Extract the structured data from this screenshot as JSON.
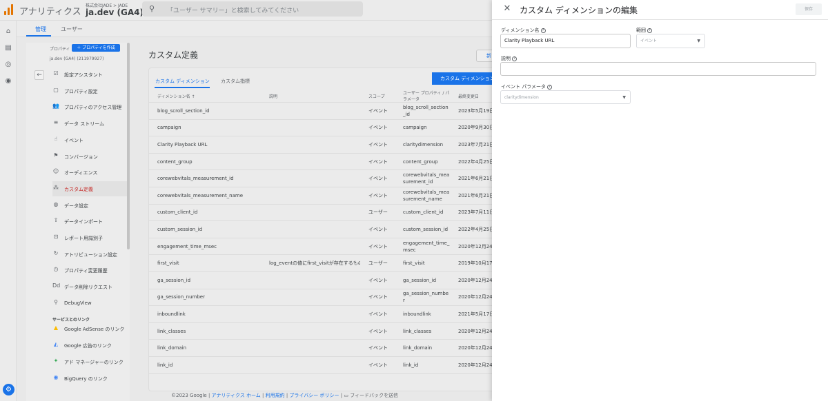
{
  "header": {
    "app_title": "アナリティクス",
    "account_breadcrumb": "株式会社JADE > JADE",
    "property": "ja.dev (GA4)",
    "search_placeholder": "「ユーザー サマリー」と検索してみてください"
  },
  "top_tabs": [
    "管理",
    "ユーザー"
  ],
  "nav": {
    "property_label": "プロパティ",
    "create_property": "プロパティを作成",
    "property_id": "ja.dev (GA4) (211979927)",
    "items": [
      {
        "icon": "checklist-icon",
        "label": "設定アシスタント"
      },
      {
        "icon": "property-icon",
        "label": "プロパティ設定"
      },
      {
        "icon": "people-icon",
        "label": "プロパティのアクセス管理"
      },
      {
        "icon": "stream-icon",
        "label": "データ ストリーム"
      },
      {
        "icon": "event-icon",
        "label": "イベント"
      },
      {
        "icon": "flag-icon",
        "label": "コンバージョン"
      },
      {
        "icon": "audience-icon",
        "label": "オーディエンス"
      },
      {
        "icon": "custom-icon",
        "label": "カスタム定義"
      },
      {
        "icon": "database-icon",
        "label": "データ設定"
      },
      {
        "icon": "upload-icon",
        "label": "データインポート"
      },
      {
        "icon": "id-icon",
        "label": "レポート用識別子"
      },
      {
        "icon": "attribution-icon",
        "label": "アトリビューション設定"
      },
      {
        "icon": "history-icon",
        "label": "プロパティ変更履歴"
      },
      {
        "icon": "delete-request-icon",
        "label": "データ削除リクエスト"
      },
      {
        "icon": "debug-icon",
        "label": "DebugView"
      }
    ],
    "links_section": "サービスとのリンク",
    "links": [
      {
        "icon": "adsense-icon",
        "label": "Google AdSense のリンク"
      },
      {
        "icon": "google-ads-icon",
        "label": "Google 広告のリンク"
      },
      {
        "icon": "ad-manager-icon",
        "label": "アド マネージャーのリンク"
      },
      {
        "icon": "bigquery-icon",
        "label": "BigQuery のリンク"
      }
    ],
    "active_index": 7
  },
  "main": {
    "title": "カスタム定義",
    "new_button": "新",
    "tabs": [
      "カスタム ディメンション",
      "カスタム指標"
    ],
    "create_button": "カスタム ディメンション",
    "columns": [
      "ディメンション名 ↑",
      "説明",
      "スコープ",
      "ユーザー プロパティ / パラメータ",
      "最終変更日"
    ],
    "rows": [
      [
        "blog_scroll_section_id",
        "",
        "イベント",
        "blog_scroll_section_id",
        "2023年5月19日"
      ],
      [
        "campaign",
        "",
        "イベント",
        "campaign",
        "2020年9月30日"
      ],
      [
        "Clarity Playback URL",
        "",
        "イベント",
        "claritydimension",
        "2023年7月21日"
      ],
      [
        "content_group",
        "",
        "イベント",
        "content_group",
        "2022年4月25日"
      ],
      [
        "corewebvitals_measurement_id",
        "",
        "イベント",
        "corewebvitals_measurement_id",
        "2021年6月21日"
      ],
      [
        "corewebvitals_measurement_name",
        "",
        "イベント",
        "corewebvitals_measurement_name",
        "2021年6月21日"
      ],
      [
        "custom_client_id",
        "",
        "ユーザー",
        "custom_client_id",
        "2023年7月11日"
      ],
      [
        "custom_session_id",
        "",
        "イベント",
        "custom_session_id",
        "2022年4月25日"
      ],
      [
        "engagement_time_msec",
        "",
        "イベント",
        "engagement_time_msec",
        "2020年12月24日"
      ],
      [
        "first_visit",
        "log_eventの値にfirst_visitが存在するもの",
        "ユーザー",
        "first_visit",
        "2019年10月17日"
      ],
      [
        "ga_session_id",
        "",
        "イベント",
        "ga_session_id",
        "2020年12月24日"
      ],
      [
        "ga_session_number",
        "",
        "イベント",
        "ga_session_number",
        "2020年12月24日"
      ],
      [
        "inboundlink",
        "",
        "イベント",
        "inboundlink",
        "2021年5月17日"
      ],
      [
        "link_classes",
        "",
        "イベント",
        "link_classes",
        "2020年12月24日"
      ],
      [
        "link_domain",
        "",
        "イベント",
        "link_domain",
        "2020年12月24日"
      ],
      [
        "link_id",
        "",
        "イベント",
        "link_id",
        "2020年12月24日"
      ]
    ]
  },
  "footer": {
    "copyright": "©2023 Google",
    "links": [
      "アナリティクス ホーム",
      "利用規約",
      "プライバシー ポリシー"
    ],
    "feedback": "フィードバックを送信"
  },
  "panel": {
    "title": "カスタム ディメンションの編集",
    "save_label": "保存",
    "dimension_name_label": "ディメンション名",
    "dimension_name_value": "Clarity Playback URL",
    "scope_label": "範囲",
    "scope_value": "イベント",
    "description_label": "説明",
    "description_value": "",
    "event_param_label": "イベント パラメータ",
    "event_param_value": "claritydimension"
  }
}
